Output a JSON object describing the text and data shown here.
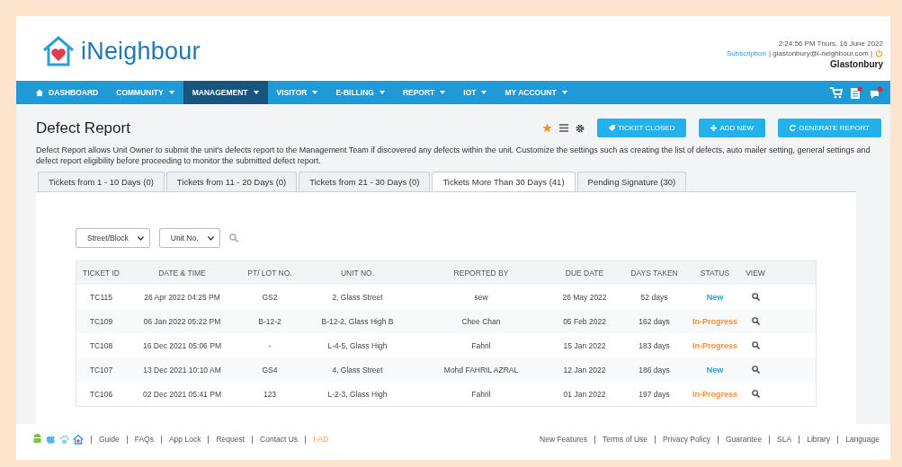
{
  "header": {
    "brand": "iNeighbour",
    "datetime": "2:24:56 PM  Thurs, 16 June 2022",
    "subscription_link": "Subscription",
    "email": "| glastonbury@i-neighbour.com |",
    "site": "Glastonbury"
  },
  "nav": [
    {
      "label": "DASHBOARD",
      "kind": "home",
      "selected": false
    },
    {
      "label": "COMMUNITY",
      "kind": "menu",
      "selected": false
    },
    {
      "label": "MANAGEMENT",
      "kind": "menu",
      "selected": true
    },
    {
      "label": "VISITOR",
      "kind": "menu",
      "selected": false
    },
    {
      "label": "E-BILLING",
      "kind": "menu",
      "selected": false
    },
    {
      "label": "REPORT",
      "kind": "menu",
      "selected": false
    },
    {
      "label": "IOT",
      "kind": "menu",
      "selected": false
    },
    {
      "label": "MY ACCOUNT",
      "kind": "menu",
      "selected": false
    }
  ],
  "page": {
    "title": "Defect Report",
    "description": "Defect Report allows Unit Owner to submit the unit's defects report to the Management Team if discovered any defects within the unit. Customize the settings such as creating the list of defects, auto mailer setting, general settings and defect report eligibility before proceeding to monitor the submitted defect report.",
    "actions": [
      {
        "label": "TICKET CLOSED",
        "kind": "tag"
      },
      {
        "label": "ADD NEW",
        "kind": "plus"
      },
      {
        "label": "GENERATE REPORT",
        "kind": "refresh"
      }
    ]
  },
  "tabs": [
    {
      "label": "Tickets from 1 - 10 Days (0)",
      "selected": false
    },
    {
      "label": "Tickets from 11 - 20 Days (0)",
      "selected": false
    },
    {
      "label": "Tickets from 21 - 30 Days (0)",
      "selected": false
    },
    {
      "label": "Tickets More Than 30 Days (41)",
      "selected": true
    },
    {
      "label": "Pending Signature (30)",
      "selected": false
    }
  ],
  "filters": [
    {
      "value": "Street/Block"
    },
    {
      "value": "Unit No."
    }
  ],
  "table": {
    "columns": [
      "TICKET ID",
      "DATE & TIME",
      "PT/ LOT NO.",
      "UNIT NO.",
      "REPORTED BY",
      "DUE DATE",
      "DAYS TAKEN",
      "STATUS",
      "VIEW"
    ],
    "rows": [
      {
        "cells": [
          "TC115",
          "26 Apr 2022 04:25 PM",
          "GS2",
          "2, Glass Street",
          "sew",
          "26 May 2022",
          "52 days"
        ],
        "status": {
          "text": "New",
          "color": "#2a9fd8"
        }
      },
      {
        "cells": [
          "TC109",
          "06 Jan 2022 05:22 PM",
          "B-12-2",
          "B-12-2, Glass High B",
          "Chee Chan",
          "05 Feb 2022",
          "162 days"
        ],
        "status": {
          "text": "In-Progress",
          "color": "#f0913a"
        }
      },
      {
        "cells": [
          "TC108",
          "16 Dec 2021 05:06 PM",
          "-",
          "L-4-5, Glass High",
          "Fahril",
          "15 Jan 2022",
          "183 days"
        ],
        "status": {
          "text": "In-Progress",
          "color": "#f0913a"
        }
      },
      {
        "cells": [
          "TC107",
          "13 Dec 2021 10:10 AM",
          "GS4",
          "4, Glass Street",
          "Mohd FAHRIL AZRAL",
          "12 Jan 2022",
          "186 days"
        ],
        "status": {
          "text": "New",
          "color": "#2a9fd8"
        }
      },
      {
        "cells": [
          "TC106",
          "02 Dec 2021 05:41 PM",
          "123",
          "L-2-3, Glass High",
          "Fahril",
          "01 Jan 2022",
          "197 days"
        ],
        "status": {
          "text": "In-Progress",
          "color": "#f0913a"
        }
      }
    ]
  },
  "footer": {
    "left_links": [
      "Guide",
      "FAQs",
      "App Lock",
      "Request",
      "Contact Us"
    ],
    "ad_link": "I-AD",
    "right_links": [
      "New Features",
      "Terms of Use",
      "Privacy Policy",
      "Guarantee",
      "SLA",
      "Library",
      "Language"
    ]
  }
}
